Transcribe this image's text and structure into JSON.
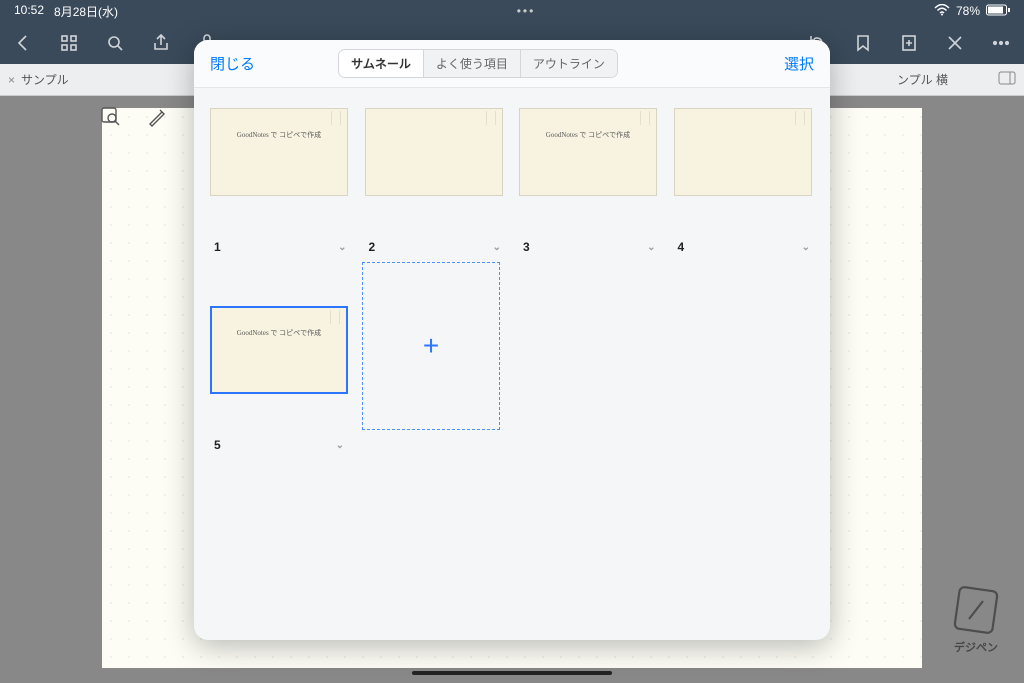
{
  "status": {
    "time": "10:52",
    "date": "8月28日(水)",
    "battery_pct": "78%"
  },
  "tab": {
    "left_label": "サンプル",
    "right_label": "ンプル 横"
  },
  "modal": {
    "close": "閉じる",
    "select": "選択",
    "segments": [
      "サムネール",
      "よく使う項目",
      "アウトライン"
    ],
    "active_segment": 0,
    "pages": [
      {
        "num": "1",
        "scribble": "GoodNotes で コピペで作成"
      },
      {
        "num": "2",
        "scribble": ""
      },
      {
        "num": "3",
        "scribble": "GoodNotes で コピペで作成"
      },
      {
        "num": "4",
        "scribble": ""
      },
      {
        "num": "5",
        "scribble": "GoodNotes で コピペで作成",
        "selected": true
      }
    ],
    "add_label": "+"
  },
  "watermark": {
    "label": "デジペン"
  }
}
